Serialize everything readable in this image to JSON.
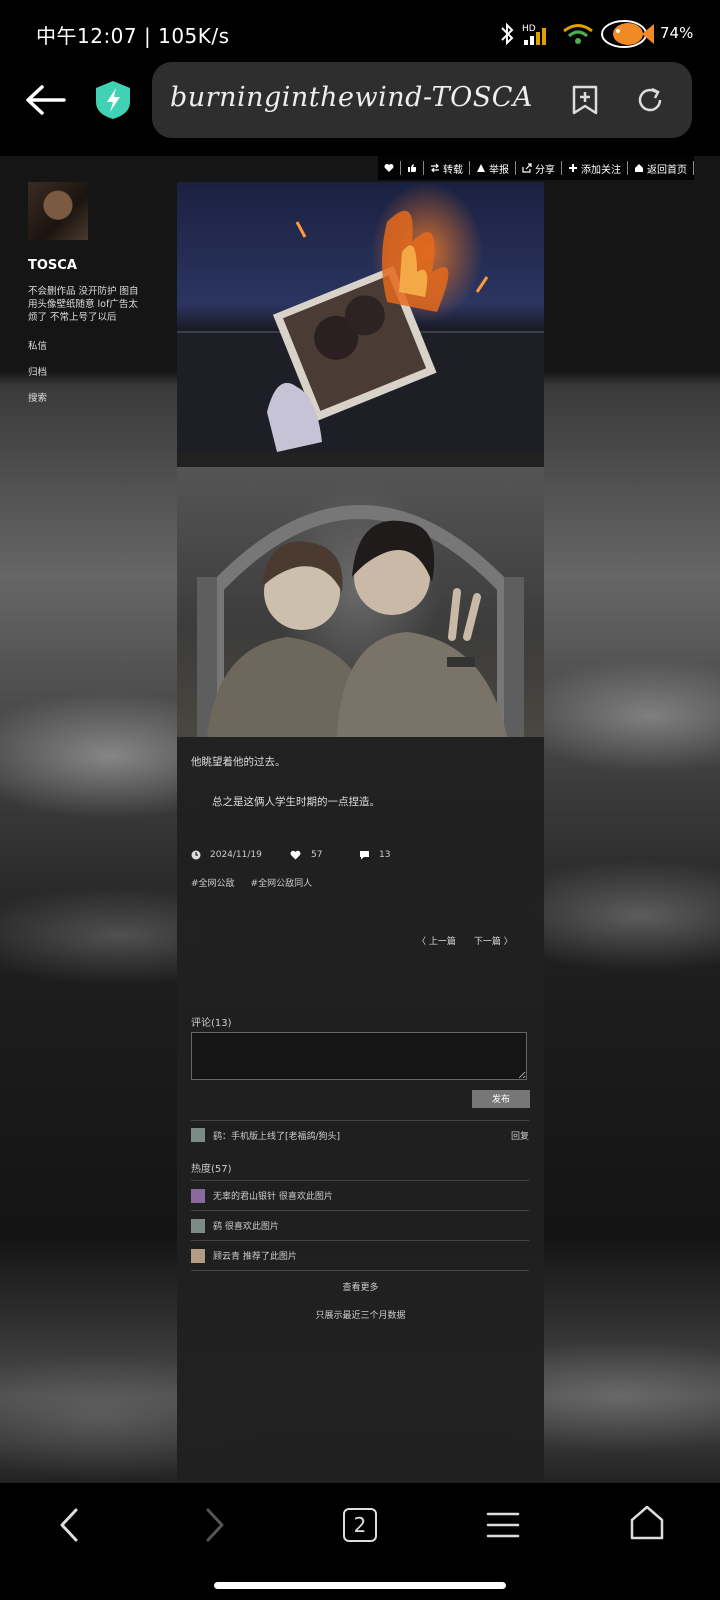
{
  "status_bar": {
    "time": "中午12:07 | 105K/s",
    "battery": "74%"
  },
  "browser": {
    "url_text": "burninginthewind-TOSCA",
    "tab_count": "2"
  },
  "topnav": {
    "items": [
      "转载",
      "举报",
      "分享",
      "添加关注",
      "返回首页"
    ]
  },
  "sidebar": {
    "title": "TOSCA",
    "bio": "不会删作品 没开防护 图自用头像壁纸随意 lof广告太烦了 不常上号了以后",
    "links": [
      "私信",
      "归档",
      "搜索"
    ]
  },
  "post": {
    "line1": "他眺望着他的过去。",
    "line2": "总之是这俩人学生时期的一点捏造。",
    "date": "2024/11/19",
    "likes": "57",
    "comments": "13",
    "tags": [
      "#全网公敌",
      "#全网公敌同人"
    ],
    "prev": "上一篇",
    "next": "下一篇"
  },
  "comments": {
    "heading": "评论(13)",
    "publish": "发布",
    "items": [
      {
        "text": "鹞：手机版上线了[老福鸽/狗头]",
        "reply": "回复"
      }
    ]
  },
  "heat": {
    "heading": "热度(57)",
    "items": [
      "无辜的君山银针 很喜欢此图片",
      "鹞 很喜欢此图片",
      "顾云青 推荐了此图片"
    ],
    "more": "查看更多",
    "note": "只展示最近三个月数据"
  }
}
